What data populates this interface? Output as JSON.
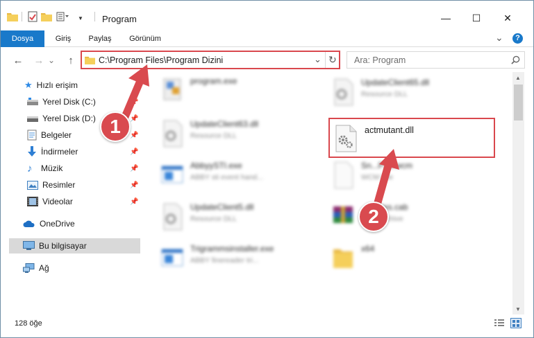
{
  "window": {
    "title": "Program",
    "minimize_glyph": "—",
    "maximize_glyph": "☐",
    "close_glyph": "✕"
  },
  "ribbon": {
    "tabs": [
      {
        "label": "Dosya",
        "active": true
      },
      {
        "label": "Giriş",
        "active": false
      },
      {
        "label": "Paylaş",
        "active": false
      },
      {
        "label": "Görünüm",
        "active": false
      }
    ],
    "help_glyph": "?",
    "expand_glyph": "⌄"
  },
  "address": {
    "path": "C:\\Program Files\\Program Dizini",
    "dropdown_glyph": "⌄",
    "refresh_glyph": "↻"
  },
  "nav_buttons": {
    "back_glyph": "←",
    "forward_glyph": "→",
    "recent_glyph": "⌄",
    "up_glyph": "↑"
  },
  "search": {
    "placeholder": "Ara: Program",
    "icon": "search-icon"
  },
  "sidebar": {
    "quick_access": "Hızlı erişim",
    "items": [
      {
        "label": "Yerel Disk (C:)",
        "icon": "drive-icon",
        "pinned": true
      },
      {
        "label": "Yerel Disk (D:)",
        "icon": "drive-icon",
        "pinned": true
      },
      {
        "label": "Belgeler",
        "icon": "documents-icon",
        "pinned": true
      },
      {
        "label": "İndirmeler",
        "icon": "download-icon",
        "pinned": true
      },
      {
        "label": "Müzik",
        "icon": "music-icon",
        "pinned": true
      },
      {
        "label": "Resimler",
        "icon": "pictures-icon",
        "pinned": true
      },
      {
        "label": "Videolar",
        "icon": "videos-icon",
        "pinned": true
      }
    ],
    "onedrive": "OneDrive",
    "this_pc": "Bu bilgisayar",
    "network": "Ağ",
    "pin_glyph": "📌"
  },
  "files": [
    {
      "name": "program.exe",
      "type": ""
    },
    {
      "name": "UpdateClient65.dll",
      "type": "Resource DLL"
    },
    {
      "name": "UpdateClient63.dll",
      "type": "Resource DLL"
    },
    {
      "name": "AbbyySTI.exe",
      "type": "ABBY sti event hand..."
    },
    {
      "name": "Sn...P16.wcm",
      "type": "WCM File"
    },
    {
      "name": "UpdateClient5.dll",
      "type": "Resource DLL"
    },
    {
      "name": "...ficates.cab",
      "type": "...AR Archive"
    },
    {
      "name": "Trigrammsinstaller.exe",
      "type": "ABBY finereader tri..."
    },
    {
      "name": "x64",
      "type": ""
    }
  ],
  "highlighted_file": {
    "name": "actmutant.dll"
  },
  "status": {
    "count": "128 öğe"
  },
  "callouts": [
    "1",
    "2"
  ],
  "colors": {
    "accent": "#1979ca",
    "highlight_red": "#d9474d",
    "callout_fill": "#d94a4f"
  }
}
